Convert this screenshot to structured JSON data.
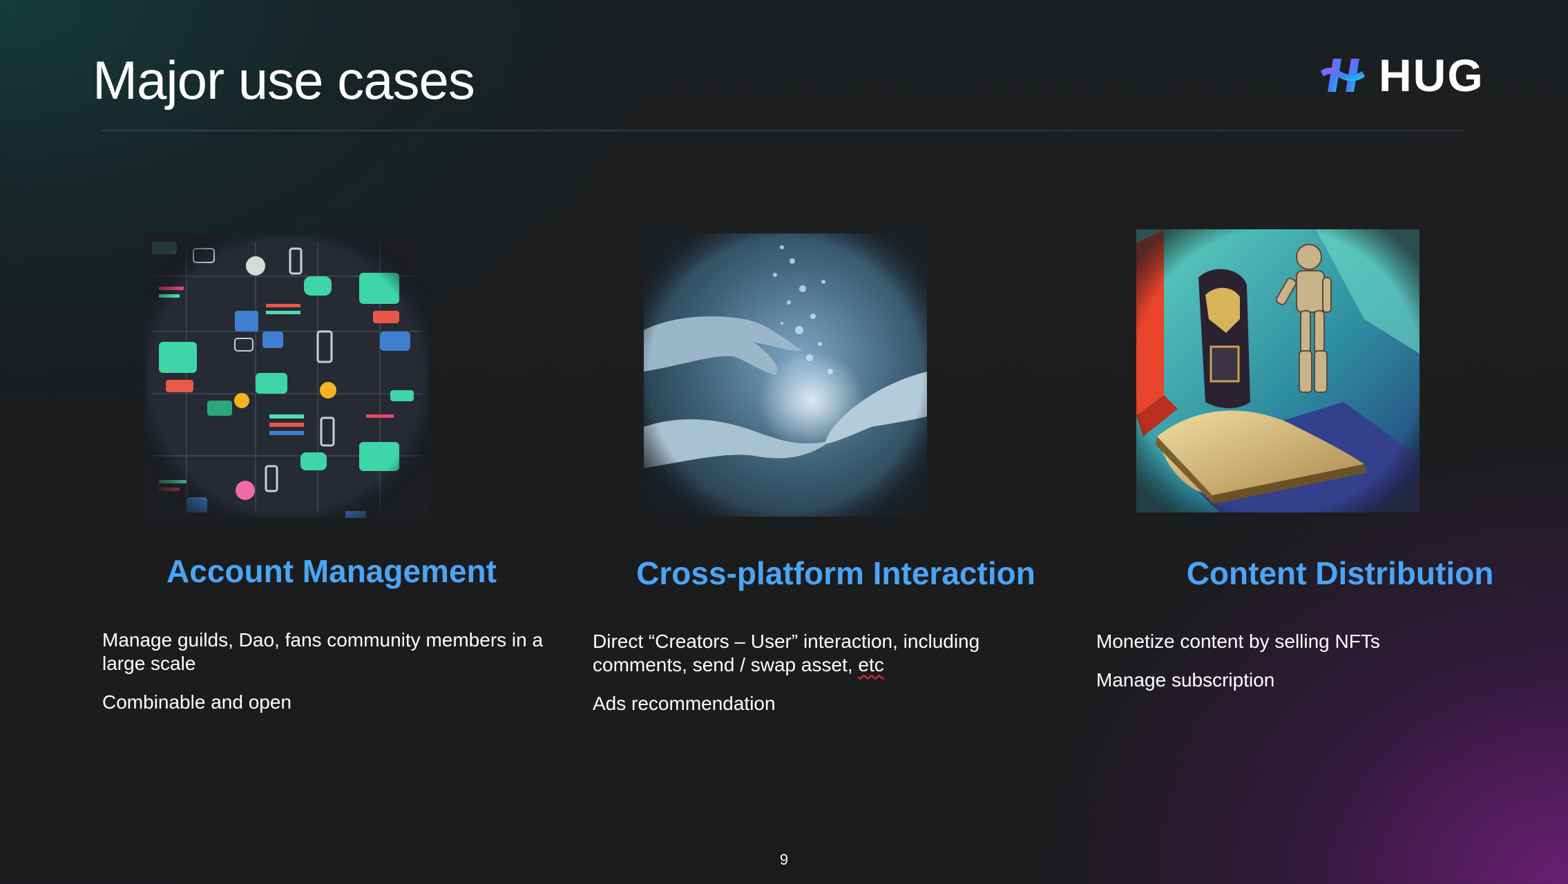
{
  "slide": {
    "title": "Major use cases",
    "page_number": "9"
  },
  "logo": {
    "text": "HUG",
    "icon": "hug-logo-icon",
    "gradient_colors": [
      "#a855f7",
      "#3b82f6",
      "#22d3ee"
    ]
  },
  "accent_color": "#4aa5f5",
  "columns": [
    {
      "title": "Account Management",
      "image_icon": "social-app-grid-illustration",
      "bullets": [
        "Manage guilds, Dao, fans community members in a large scale",
        "Combinable and open"
      ]
    },
    {
      "title": "Cross-platform Interaction",
      "image_icon": "reaching-hands-illustration",
      "bullets": [
        "Direct “Creators – User” interaction, including comments, send / swap asset, ",
        "Ads recommendation"
      ],
      "bullet_1_suffix": "etc"
    },
    {
      "title": "Content Distribution",
      "image_icon": "robot-book-illustration",
      "bullets": [
        "Monetize content by selling NFTs",
        "Manage subscription"
      ]
    }
  ]
}
